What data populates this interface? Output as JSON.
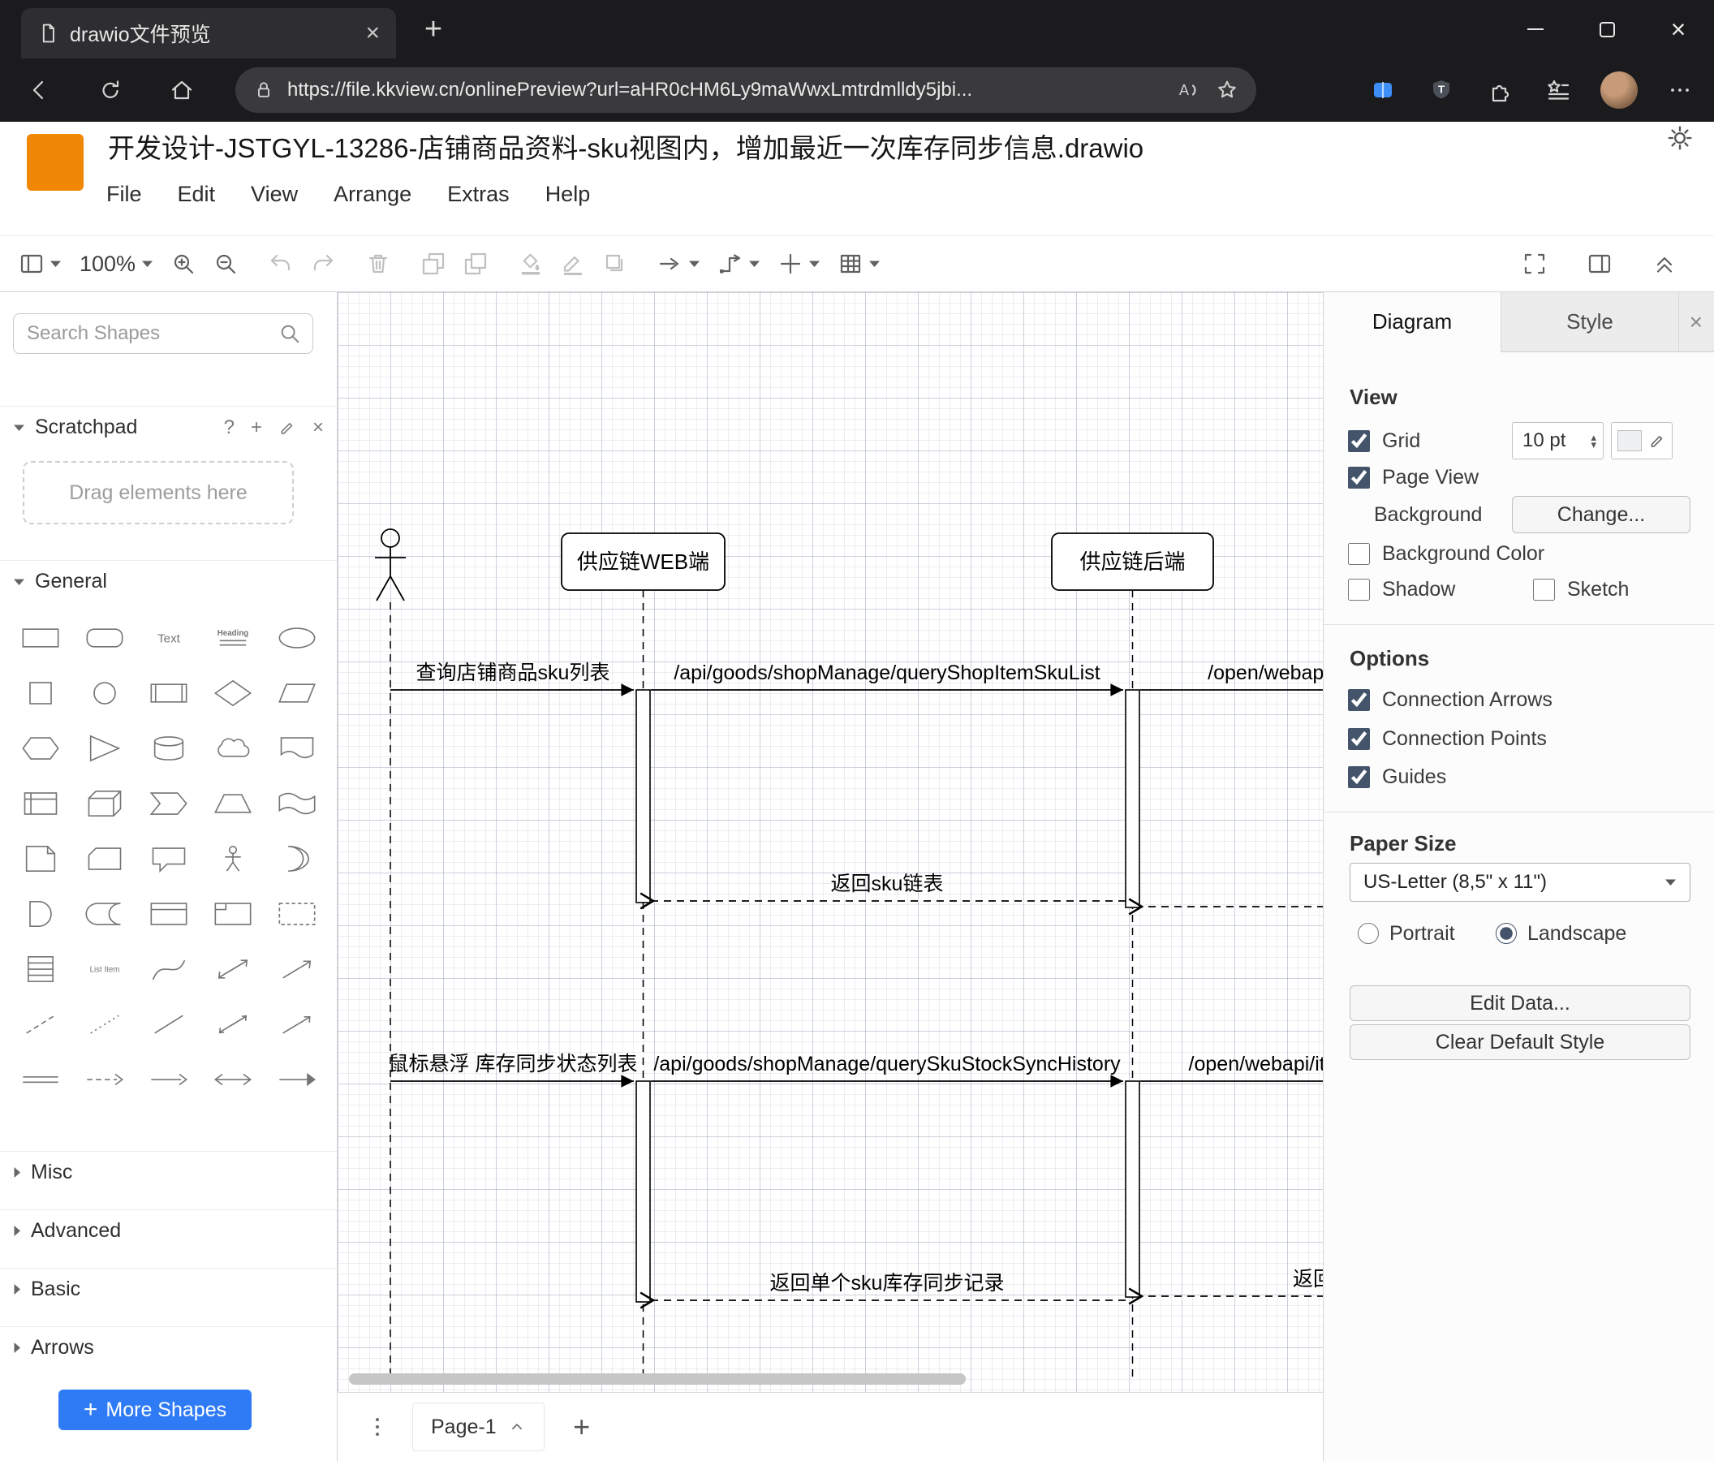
{
  "browser": {
    "tab_title": "drawio文件预览",
    "url": "https://file.kkview.cn/onlinePreview?url=aHR0cHM6Ly9maWwxLmtrdmlldy5jbi..."
  },
  "app": {
    "title": "开发设计-JSTGYL-13286-店铺商品资料-sku视图内，增加最近一次库存同步信息.drawio",
    "menus": [
      "File",
      "Edit",
      "View",
      "Arrange",
      "Extras",
      "Help"
    ]
  },
  "toolbar": {
    "zoom": "100%",
    "left": [
      {
        "name": "view-selector",
        "caret": true
      },
      {
        "name": "zoom-level",
        "zoomText": true,
        "caret": true
      },
      {
        "name": "zoom-in"
      },
      {
        "name": "zoom-out",
        "gap": true
      },
      {
        "name": "undo",
        "disabled": true
      },
      {
        "name": "redo",
        "disabled": true,
        "gap": true
      },
      {
        "name": "delete",
        "disabled": true,
        "gap": true
      },
      {
        "name": "to-front",
        "disabled": true
      },
      {
        "name": "to-back",
        "disabled": true,
        "gap": true
      },
      {
        "name": "fill-color",
        "disabled": true
      },
      {
        "name": "line-color",
        "disabled": true
      },
      {
        "name": "shadow",
        "disabled": true,
        "gap": true
      },
      {
        "name": "connection",
        "caret": true
      },
      {
        "name": "waypoints",
        "caret": true
      },
      {
        "name": "insert",
        "caret": true
      },
      {
        "name": "table",
        "caret": true
      }
    ],
    "right": [
      {
        "name": "fullscreen"
      },
      {
        "name": "format-panel"
      },
      {
        "name": "collapse"
      }
    ]
  },
  "sidebar": {
    "search_placeholder": "Search Shapes",
    "scratchpad": {
      "label": "Scratchpad",
      "hint": "Drag elements here"
    },
    "sections": {
      "general": "General",
      "misc": "Misc",
      "advanced": "Advanced",
      "basic": "Basic",
      "arrows": "Arrows"
    },
    "general_shapes": [
      "rectangle",
      "rounded-rectangle",
      "text",
      "heading",
      "ellipse",
      "square",
      "circle",
      "process",
      "diamond",
      "parallelogram",
      "hexagon",
      "triangle",
      "cylinder",
      "cloud",
      "document",
      "internal-storage",
      "cube",
      "step",
      "trapezoid",
      "tape",
      "note",
      "card",
      "callout",
      "actor",
      "or",
      "and",
      "data-storage",
      "container",
      "frame",
      "group",
      "list",
      "list-item",
      "curve",
      "bidirectional-arrow",
      "arrow",
      "dashed-line",
      "dotted-line",
      "line",
      "bidirectional-connector",
      "directional-connector",
      "link",
      "dashed-edge",
      "edge",
      "double-arrow-edge",
      "arrow-edge"
    ],
    "more_shapes": "More Shapes"
  },
  "diagram": {
    "participants": [
      {
        "type": "actor",
        "label": ""
      },
      {
        "type": "box",
        "label": "供应链WEB端"
      },
      {
        "type": "box",
        "label": "供应链后端"
      }
    ],
    "messages": [
      {
        "label": "查询店铺商品sku列表",
        "style": "solid"
      },
      {
        "label": "/api/goods/shopManage/queryShopItemSkuList",
        "style": "solid"
      },
      {
        "label": "/open/webapi/",
        "style": "solid"
      },
      {
        "label": "返回sku链表",
        "style": "dashed"
      },
      {
        "label": "",
        "style": "dashed"
      },
      {
        "label": "鼠标悬浮 库存同步状态列表",
        "style": "solid"
      },
      {
        "label": "/api/goods/shopManage/querySkuStockSyncHistory",
        "style": "solid"
      },
      {
        "label": "/open/webapi/item",
        "style": "solid"
      },
      {
        "label": "返回单个sku库存同步记录",
        "style": "dashed"
      },
      {
        "label": "返回",
        "style": "dashed"
      }
    ]
  },
  "format_panel": {
    "tabs": [
      "Diagram",
      "Style"
    ],
    "active_tab": "Diagram",
    "view": {
      "title": "View",
      "grid": {
        "label": "Grid",
        "checked": true,
        "size": "10 pt"
      },
      "page_view": {
        "label": "Page View",
        "checked": true
      },
      "background": {
        "label": "Background",
        "button": "Change..."
      },
      "background_color": {
        "label": "Background Color",
        "checked": false
      },
      "shadow": {
        "label": "Shadow",
        "checked": false
      },
      "sketch": {
        "label": "Sketch",
        "checked": false
      }
    },
    "options": {
      "title": "Options",
      "connection_arrows": {
        "label": "Connection Arrows",
        "checked": true
      },
      "connection_points": {
        "label": "Connection Points",
        "checked": true
      },
      "guides": {
        "label": "Guides",
        "checked": true
      }
    },
    "paper": {
      "title": "Paper Size",
      "value": "US-Letter (8,5\" x 11\")",
      "portrait": "Portrait",
      "landscape": "Landscape",
      "orientation": "landscape"
    },
    "buttons": {
      "edit_data": "Edit Data...",
      "clear_default_style": "Clear Default Style"
    }
  },
  "footer": {
    "page": "Page-1"
  }
}
